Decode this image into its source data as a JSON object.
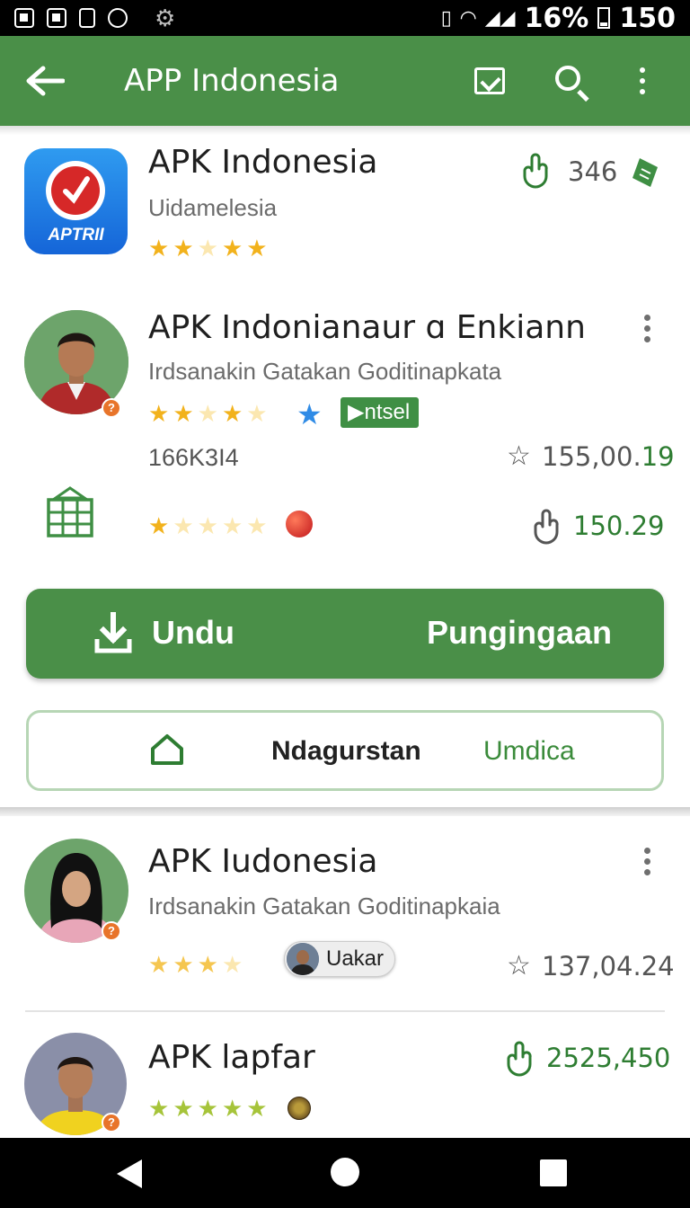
{
  "status_bar": {
    "battery": "16%",
    "time": "150"
  },
  "app_bar": {
    "title": "APP Indonesia"
  },
  "items": [
    {
      "title": "APK Indonesia",
      "logo_text": "APTRII",
      "subtitle": "Uidamelesia",
      "stars_filled": 4,
      "stars_total": 5,
      "count": "346"
    },
    {
      "title": "APK Indonianaur ɑ Enkiann",
      "subtitle": "Irdsanakin Gatakan Goditinapkata",
      "stars_filled": 3,
      "stars_total": 5,
      "chip": "ntsel",
      "code": "166K3I4",
      "rating_value_main": "155,00.",
      "rating_value_accent": "19",
      "stars2_filled": 1,
      "stars2_total": 5,
      "count2": "150.29"
    },
    {
      "title": "APK Iudonesia",
      "subtitle": "Irdsanakin Gatakan Goditinapkaia",
      "stars_filled": 3,
      "stars_total": 4,
      "chip": "Uakar",
      "rating_value": "137,04.24"
    },
    {
      "title": "APK lapfar",
      "stars_filled": 5,
      "stars_total": 5,
      "count": "2525,450"
    }
  ],
  "download_button": {
    "label": "Undu",
    "right_label": "Pungingaan"
  },
  "secondary_button": {
    "label": "Ndagurstan",
    "right_label": "Umdica"
  },
  "colors": {
    "primary": "#4a8f48",
    "star": "#f2b21c",
    "accent_text": "#2e7d32"
  }
}
